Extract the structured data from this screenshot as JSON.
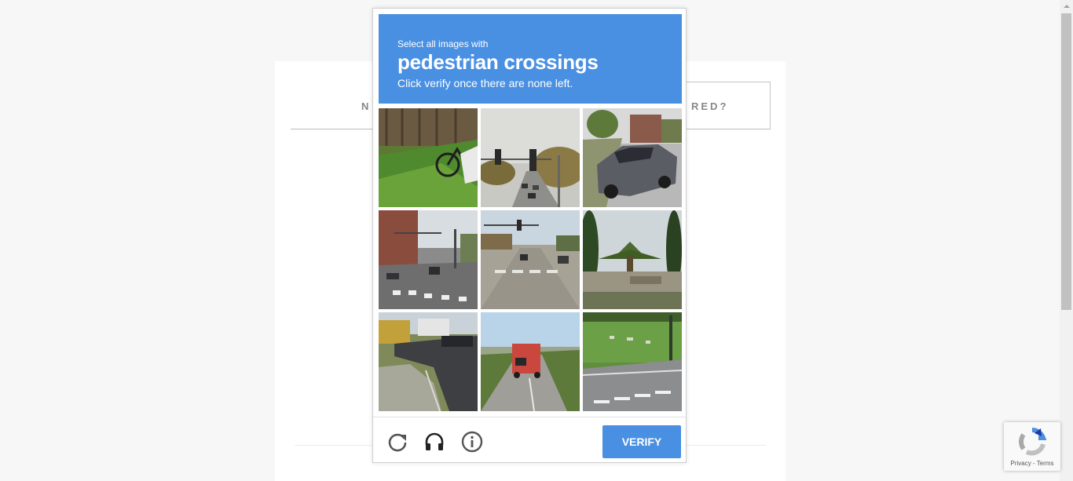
{
  "background": {
    "tab_left_label": "N",
    "tab_right_label": "RED?"
  },
  "challenge": {
    "instruction_line1": "Select all images with",
    "target_object": "pedestrian crossings",
    "instruction_line3": "Click verify once there are none left.",
    "header_color": "#4a90e2",
    "tiles": [
      {
        "scene": "grass with bicycle"
      },
      {
        "scene": "traffic lights over road"
      },
      {
        "scene": "grey sedan by sidewalk"
      },
      {
        "scene": "city street with crosswalk"
      },
      {
        "scene": "road with crosswalk and traffic lights"
      },
      {
        "scene": "palm tree and sign"
      },
      {
        "scene": "curved road with cars"
      },
      {
        "scene": "red truck on highway"
      },
      {
        "scene": "grass field by road with crosswalk"
      }
    ],
    "footer": {
      "reload_icon": "reload-icon",
      "audio_icon": "headphones-icon",
      "info_icon": "info-icon",
      "verify_label": "VERIFY"
    }
  },
  "badge": {
    "text": "Privacy - Terms"
  }
}
